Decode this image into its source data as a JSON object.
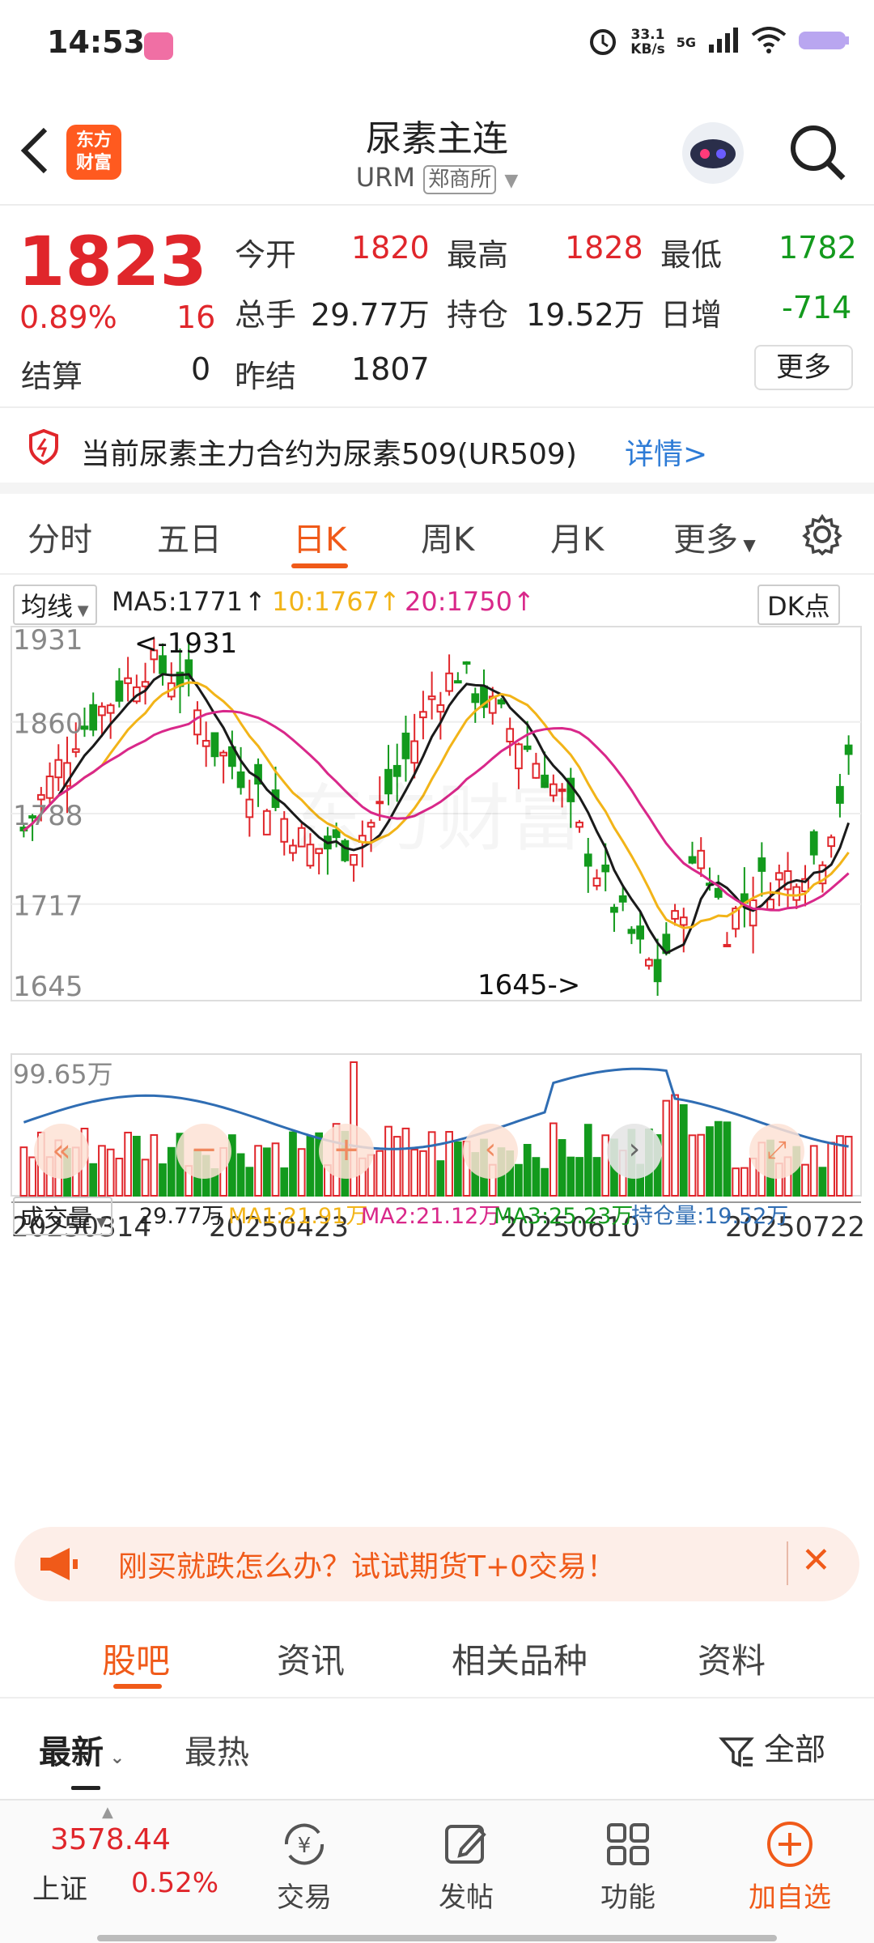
{
  "status": {
    "time": "14:53",
    "speed_top": "33.1",
    "speed_bottom": "KB/s",
    "net": "5G"
  },
  "header": {
    "title": "尿素主连",
    "code": "URM",
    "exchange": "郑商所",
    "logo_line1": "东方",
    "logo_line2": "财富"
  },
  "quote": {
    "price": "1823",
    "change_pct": "0.89%",
    "change": "16",
    "open_label": "今开",
    "open": "1820",
    "high_label": "最高",
    "high": "1828",
    "low_label": "最低",
    "low": "1782",
    "volume_label": "总手",
    "volume": "29.77万",
    "oi_label": "持仓",
    "oi": "19.52万",
    "daily_inc_label": "日增",
    "daily_inc": "-714",
    "settle_label": "结算",
    "settle": "0",
    "prev_settle_label": "昨结",
    "prev_settle": "1807",
    "more_label": "更多"
  },
  "notice": {
    "text": "当前尿素主力合约为尿素509(UR509)",
    "link": "详情>"
  },
  "ktabs": {
    "items": [
      "分时",
      "五日",
      "日K",
      "周K",
      "月K",
      "更多"
    ],
    "active": 2
  },
  "ma_bar": {
    "selector": "均线",
    "ma5": "MA5:1771",
    "ma10": "10:1767",
    "ma20": "20:1750",
    "dk": "DK点"
  },
  "colors": {
    "up": "#e0262b",
    "down": "#139a1d",
    "ma5": "#1a1a1a",
    "ma10": "#f2b418",
    "ma20": "#d9288a",
    "accent": "#f05a19",
    "oi": "#2f6db3"
  },
  "chart_data": {
    "type": "candlestick",
    "y_ticks": [
      "1931",
      "1860",
      "1788",
      "1717",
      "1645"
    ],
    "ylim": [
      1645,
      1931
    ],
    "max_label": "<-1931",
    "min_label": "1645->",
    "x_labels": [
      "20250314",
      "20250423",
      "20250610",
      "20250722"
    ],
    "volume_max_label": "99.65万"
  },
  "vol_bar": {
    "selector": "成交量",
    "vol": "29.77万",
    "ma1": "MA1:21.91万",
    "ma2": "MA2:21.12万",
    "ma3": "MA3:25.23万",
    "oi": "持仓量:19.52万"
  },
  "banner": {
    "text": "刚买就跌怎么办？试试期货T+0交易！"
  },
  "btabs": {
    "items": [
      "股吧",
      "资讯",
      "相关品种",
      "资料"
    ],
    "active": 0
  },
  "filter": {
    "latest": "最新",
    "hot": "最热",
    "all": "全部"
  },
  "bottom": {
    "index_value": "3578.44",
    "index_name": "上证",
    "index_change": "0.52%",
    "nav": [
      "交易",
      "发帖",
      "功能",
      "加自选"
    ]
  }
}
